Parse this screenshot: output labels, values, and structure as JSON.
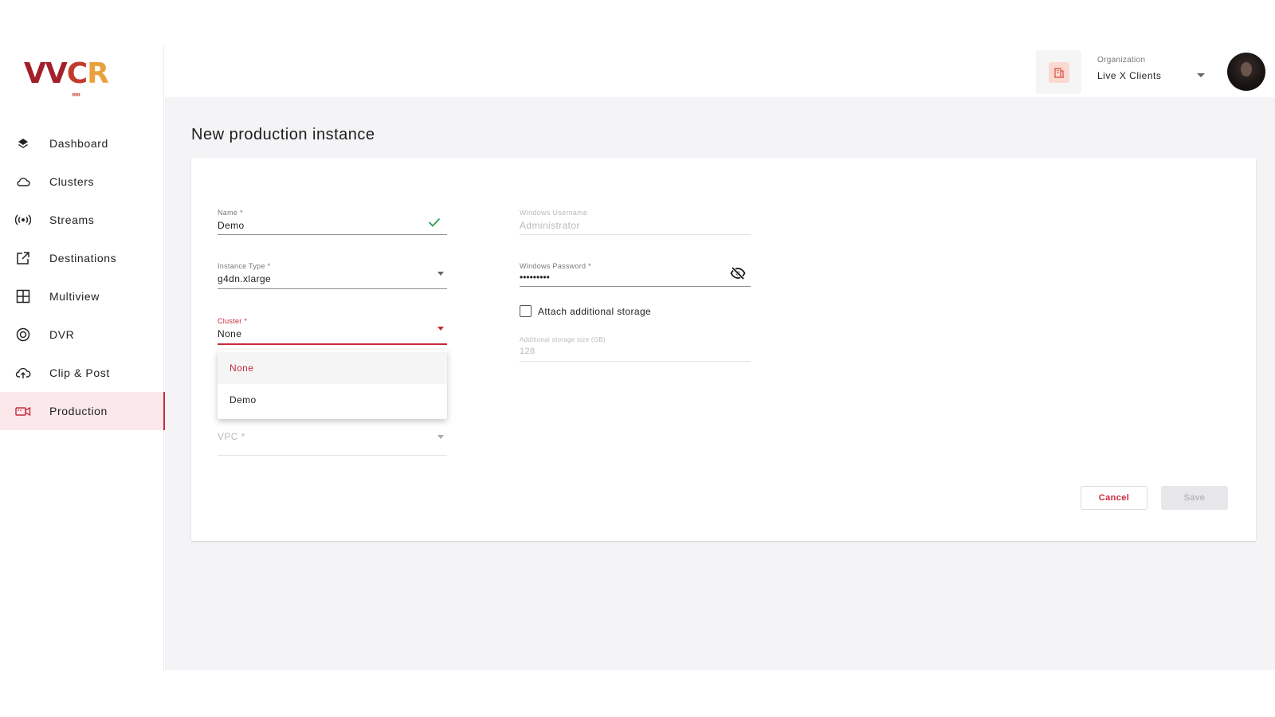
{
  "brand": {
    "logo_text": "VVCR"
  },
  "sidebar": {
    "items": [
      {
        "label": "Dashboard",
        "icon": "layers-icon"
      },
      {
        "label": "Clusters",
        "icon": "cloud-icon"
      },
      {
        "label": "Streams",
        "icon": "broadcast-icon"
      },
      {
        "label": "Destinations",
        "icon": "external-link-icon"
      },
      {
        "label": "Multiview",
        "icon": "grid-icon"
      },
      {
        "label": "DVR",
        "icon": "record-icon"
      },
      {
        "label": "Clip & Post",
        "icon": "cloud-upload-icon"
      },
      {
        "label": "Production",
        "icon": "video-camera-icon",
        "active": true
      }
    ]
  },
  "header": {
    "org_label": "Organization",
    "org_value": "Live X Clients"
  },
  "page": {
    "title": "New production instance"
  },
  "form": {
    "name": {
      "label": "Name *",
      "value": "Demo"
    },
    "instance_type": {
      "label": "Instance Type *",
      "value": "g4dn.xlarge"
    },
    "cluster": {
      "label": "Cluster *",
      "value": "None",
      "options": [
        "None",
        "Demo"
      ]
    },
    "vpc": {
      "label": "VPC *",
      "value": ""
    },
    "windows_username": {
      "label": "Windows Username",
      "value": "Administrator"
    },
    "windows_password": {
      "label": "Windows Password *",
      "value": "•••••••••"
    },
    "attach_storage": {
      "label": "Attach additional storage",
      "checked": false
    },
    "storage_size": {
      "label": "Additional storage size (GB)",
      "value": "128"
    },
    "cancel_label": "Cancel",
    "save_label": "Save"
  },
  "colors": {
    "accent": "#c72a3c",
    "success": "#2e9d4f",
    "active_bg": "#fbe8ea"
  }
}
